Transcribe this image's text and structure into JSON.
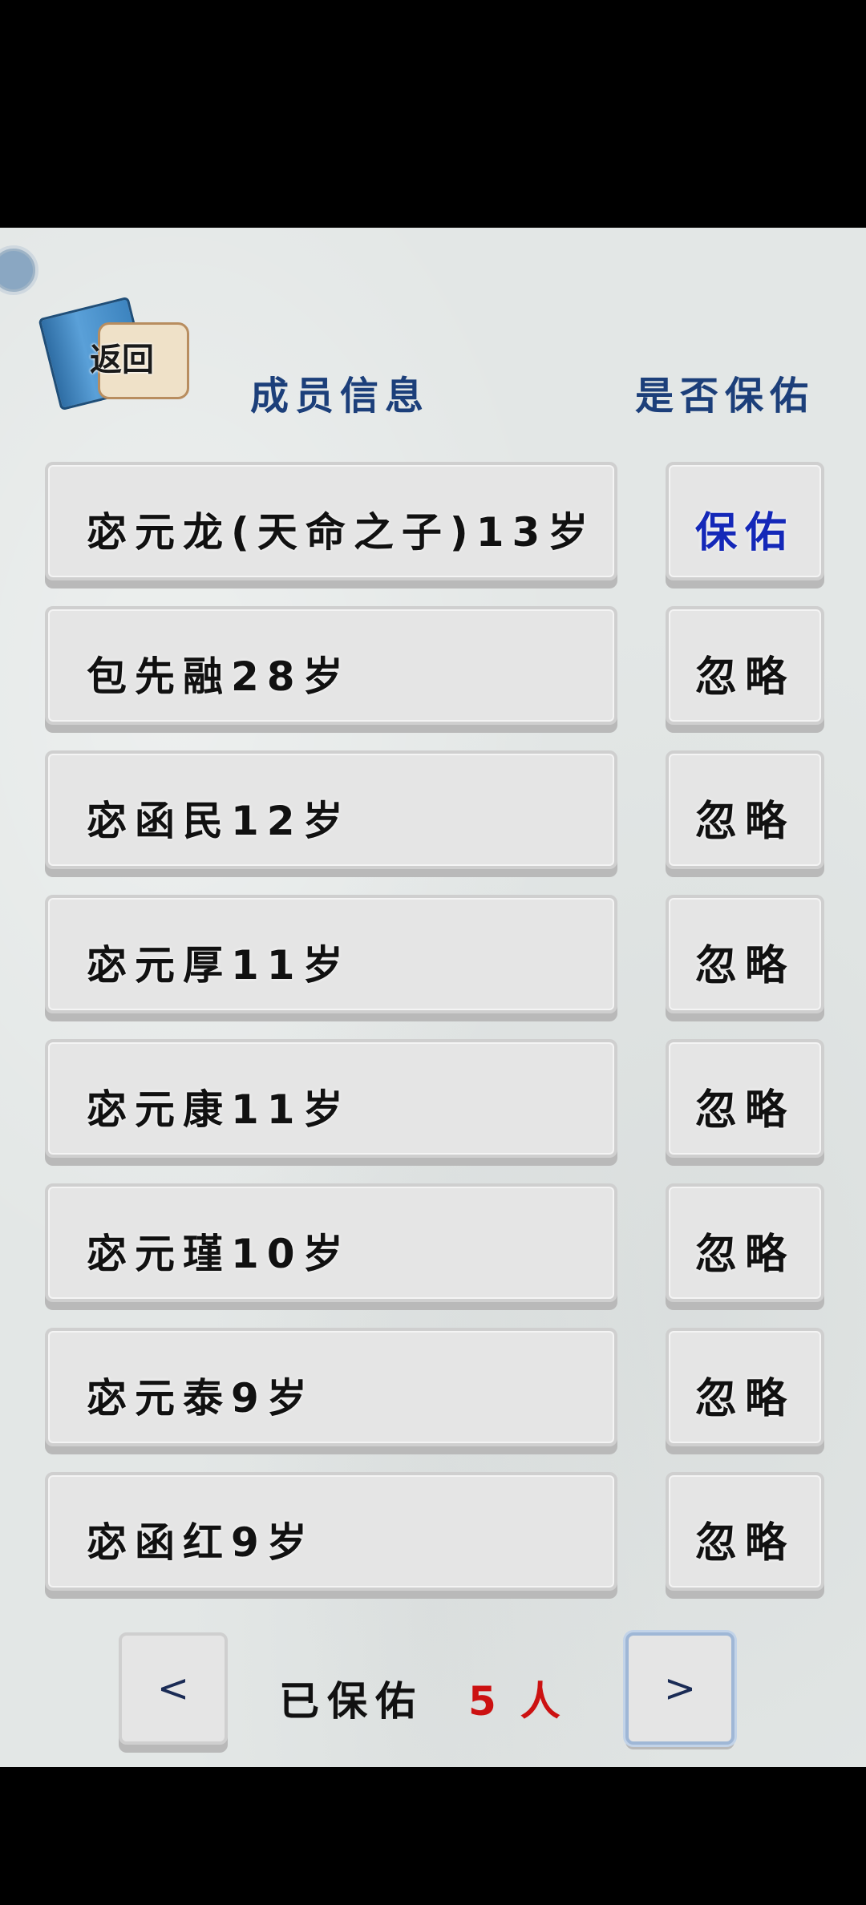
{
  "header": {
    "back_label": "返回",
    "member_info_title": "成员信息",
    "protect_title": "是否保佑"
  },
  "rows": [
    {
      "info": "宓元龙(天命之子)13岁",
      "action": "保佑",
      "status": "protected"
    },
    {
      "info": "包先融28岁",
      "action": "忽略",
      "status": "ignored"
    },
    {
      "info": "宓函民12岁",
      "action": "忽略",
      "status": "ignored"
    },
    {
      "info": "宓元厚11岁",
      "action": "忽略",
      "status": "ignored"
    },
    {
      "info": "宓元康11岁",
      "action": "忽略",
      "status": "ignored"
    },
    {
      "info": "宓元瑾10岁",
      "action": "忽略",
      "status": "ignored"
    },
    {
      "info": "宓元泰9岁",
      "action": "忽略",
      "status": "ignored"
    },
    {
      "info": "宓函红9岁",
      "action": "忽略",
      "status": "ignored"
    }
  ],
  "footer": {
    "prev_label": "<",
    "next_label": ">",
    "protected_label": "已保佑",
    "protected_count": "5",
    "count_unit": "人"
  },
  "colors": {
    "title_blue": "#1c3f7a",
    "protect_blue": "#1428b8",
    "count_red": "#cc1111"
  }
}
